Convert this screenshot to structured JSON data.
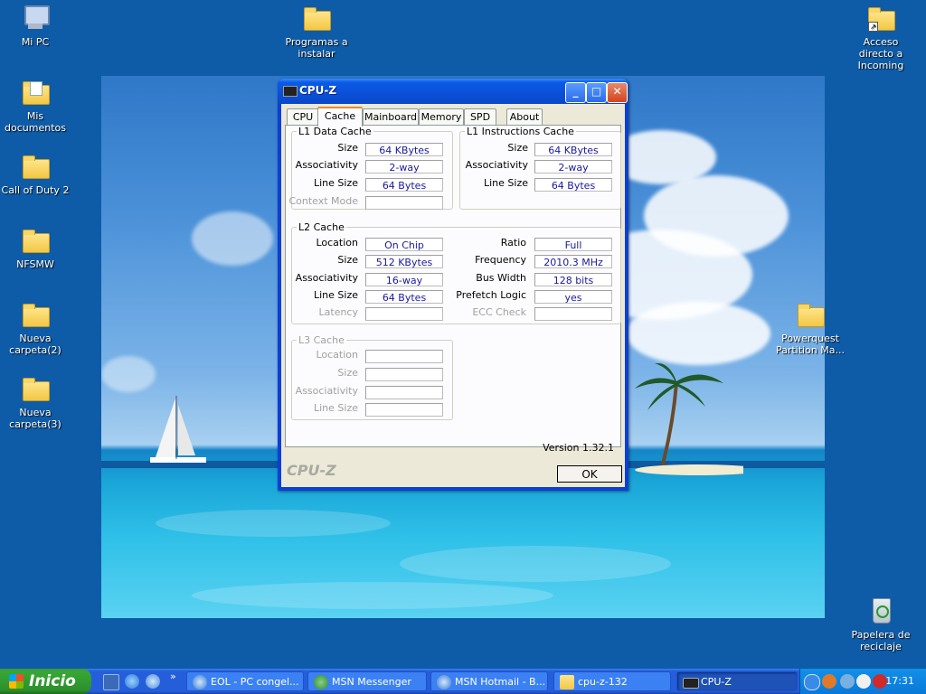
{
  "desktop": {
    "icons": [
      {
        "label": "Mi PC",
        "icon": "my-computer-icon"
      },
      {
        "label": "Mis documentos",
        "icon": "my-documents-icon"
      },
      {
        "label": "Call of Duty 2",
        "icon": "folder-icon"
      },
      {
        "label": "NFSMW",
        "icon": "folder-icon"
      },
      {
        "label": "Nueva carpeta(2)",
        "icon": "folder-icon"
      },
      {
        "label": "Nueva carpeta(3)",
        "icon": "folder-icon"
      },
      {
        "label": "Programas a instalar",
        "icon": "folder-icon"
      },
      {
        "label": "Acceso directo a Incoming",
        "icon": "folder-shortcut-icon"
      },
      {
        "label": "Powerquest Partition Ma...",
        "icon": "folder-icon"
      },
      {
        "label": "Papelera de reciclaje",
        "icon": "recycle-bin-icon"
      }
    ]
  },
  "window": {
    "title": "CPU-Z",
    "tabs": [
      "CPU",
      "Cache",
      "Mainboard",
      "Memory",
      "SPD",
      "About"
    ],
    "active_tab": "Cache",
    "l1_data": {
      "legend": "L1 Data Cache",
      "size_label": "Size",
      "size": "64 KBytes",
      "assoc_label": "Associativity",
      "assoc": "2-way",
      "line_label": "Line Size",
      "line": "64 Bytes",
      "context_label": "Context Mode",
      "context": ""
    },
    "l1_instr": {
      "legend": "L1 Instructions Cache",
      "size_label": "Size",
      "size": "64 KBytes",
      "assoc_label": "Associativity",
      "assoc": "2-way",
      "line_label": "Line Size",
      "line": "64 Bytes"
    },
    "l2": {
      "legend": "L2 Cache",
      "location_label": "Location",
      "location": "On Chip",
      "size_label": "Size",
      "size": "512 KBytes",
      "assoc_label": "Associativity",
      "assoc": "16-way",
      "line_label": "Line Size",
      "line": "64 Bytes",
      "latency_label": "Latency",
      "latency": "",
      "ratio_label": "Ratio",
      "ratio": "Full",
      "freq_label": "Frequency",
      "freq": "2010.3 MHz",
      "bus_label": "Bus Width",
      "bus": "128 bits",
      "prefetch_label": "Prefetch Logic",
      "prefetch": "yes",
      "ecc_label": "ECC Check",
      "ecc": ""
    },
    "l3": {
      "legend": "L3 Cache",
      "location_label": "Location",
      "size_label": "Size",
      "assoc_label": "Associativity",
      "line_label": "Line Size"
    },
    "version": "Version 1.32.1",
    "brand": "CPU-Z",
    "ok_label": "OK",
    "buttons": {
      "minimize": "_",
      "maximize": "□",
      "close": "✕"
    }
  },
  "taskbar": {
    "start_label": "Inicio",
    "tasks": [
      {
        "label": "EOL - PC congel...",
        "active": false
      },
      {
        "label": "MSN Messenger",
        "active": false
      },
      {
        "label": "MSN Hotmail - B...",
        "active": false
      },
      {
        "label": "cpu-z-132",
        "active": false
      },
      {
        "label": "CPU-Z",
        "active": true
      }
    ],
    "clock": "17:31",
    "chevron": "»"
  },
  "colors": {
    "desktop_bg": "#0e5ca8",
    "titlebar": "#0a5be6",
    "client_bg": "#ece9d8",
    "value_text": "#1a1a9a",
    "start_green": "#37a636",
    "taskbar_blue": "#245edb"
  }
}
